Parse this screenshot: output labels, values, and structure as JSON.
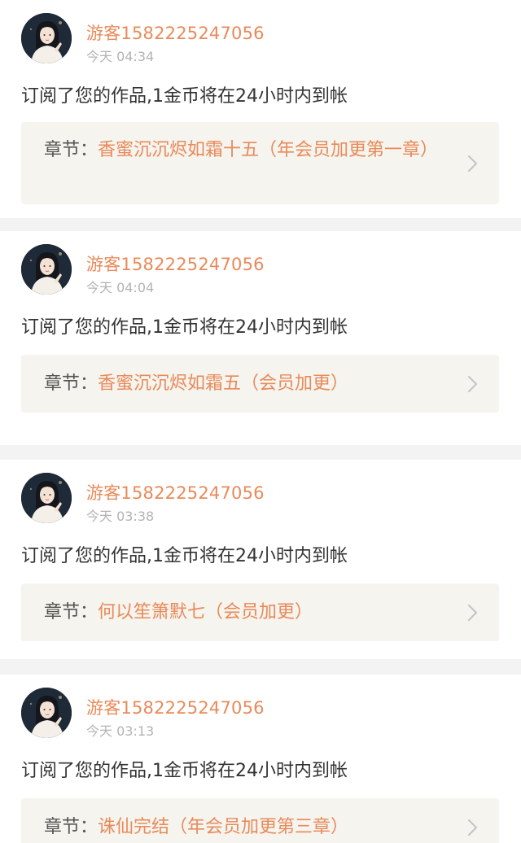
{
  "colors": {
    "accent": "#e98a5a",
    "text": "#333333",
    "muted": "#b3b3b3",
    "chapter_bg": "#f5f4ee",
    "divider": "#f3f3f3"
  },
  "notifications": [
    {
      "username": "游客1582225247056",
      "time": "今天 04:34",
      "message": "订阅了您的作品,1金币将在24小时内到帐",
      "chapter_prefix": "章节：",
      "chapter_title": "香蜜沉沉烬如霜十五（年会员加更第一章）",
      "avatar_icon": "user-avatar",
      "chevron_icon": "chevron-right-icon"
    },
    {
      "username": "游客1582225247056",
      "time": "今天 04:04",
      "message": "订阅了您的作品,1金币将在24小时内到帐",
      "chapter_prefix": "章节：",
      "chapter_title": "香蜜沉沉烬如霜五（会员加更）",
      "avatar_icon": "user-avatar",
      "chevron_icon": "chevron-right-icon"
    },
    {
      "username": "游客1582225247056",
      "time": "今天 03:38",
      "message": "订阅了您的作品,1金币将在24小时内到帐",
      "chapter_prefix": "章节：",
      "chapter_title": "何以笙箫默七（会员加更）",
      "avatar_icon": "user-avatar",
      "chevron_icon": "chevron-right-icon"
    },
    {
      "username": "游客1582225247056",
      "time": "今天 03:13",
      "message": "订阅了您的作品,1金币将在24小时内到帐",
      "chapter_prefix": "章节：",
      "chapter_title": "诛仙完结（年会员加更第三章）",
      "avatar_icon": "user-avatar",
      "chevron_icon": "chevron-right-icon"
    }
  ]
}
